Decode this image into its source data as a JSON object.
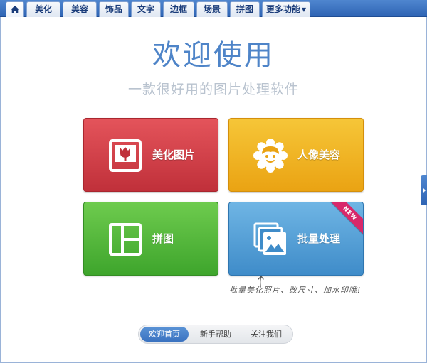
{
  "tabs": [
    {
      "label": "",
      "icon": "home-icon"
    },
    {
      "label": "美化"
    },
    {
      "label": "美容"
    },
    {
      "label": "饰品"
    },
    {
      "label": "文字"
    },
    {
      "label": "边框"
    },
    {
      "label": "场景"
    },
    {
      "label": "拼图"
    },
    {
      "label": "更多功能"
    }
  ],
  "welcome": {
    "title": "欢迎使用",
    "subtitle": "一款很好用的图片处理软件"
  },
  "cards": [
    {
      "label": "美化图片",
      "icon": "photo-flower-icon",
      "color": "#d63e47"
    },
    {
      "label": "人像美容",
      "icon": "face-flower-icon",
      "color": "#f0b423"
    },
    {
      "label": "拼图",
      "icon": "collage-layout-icon",
      "color": "#52b73b"
    },
    {
      "label": "批量处理",
      "icon": "stacked-photos-icon",
      "color": "#559fd6",
      "badge": "NEW"
    }
  ],
  "hint": "批量美化照片、改尺寸、加水印哦!",
  "bottom_nav": [
    {
      "label": "欢迎首页",
      "active": true
    },
    {
      "label": "新手帮助",
      "active": false
    },
    {
      "label": "关注我们",
      "active": false
    }
  ],
  "colors": {
    "tab_bar": "#2e64b4",
    "title": "#4e84c8",
    "subtitle": "#b9c3cf"
  }
}
